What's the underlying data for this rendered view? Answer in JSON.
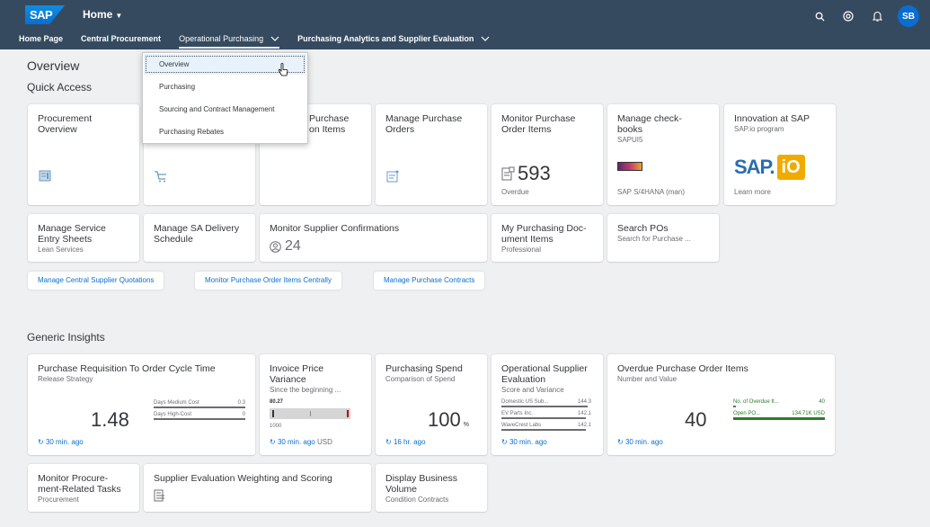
{
  "shell": {
    "logo": "SAP",
    "title": "Home",
    "avatar": "SB",
    "nav": [
      "Home Page",
      "Central Procurement",
      "Operational Purchasing",
      "Purchasing Analytics and Supplier Evaluation"
    ]
  },
  "menu": {
    "items": [
      "Overview",
      "Purchasing",
      "Sourcing and Contract Management",
      "Purchasing Rebates"
    ]
  },
  "page": {
    "title": "Overview",
    "quick_access": "Quick Access",
    "generic_insights": "Generic Insights"
  },
  "quick": {
    "t1": {
      "title": "Procurement Overview"
    },
    "t3": {
      "title_a": "Purchase",
      "title_b": "on Items"
    },
    "t4": {
      "title": "Manage Purchase Orders"
    },
    "t5": {
      "title": "Monitor Purchase Order Items",
      "kpi": "593",
      "foot": "Overdue"
    },
    "t6": {
      "title": "Manage check-books",
      "sub": "SAPUI5",
      "foot": "SAP S/4HANA (man)"
    },
    "t7": {
      "title": "Innovation at SAP",
      "sub": "SAP.io program",
      "logo": "SAP.",
      "logo2": "iO",
      "foot": "Learn more"
    },
    "r2a": {
      "title": "Manage Service Entry Sheets",
      "sub": "Lean Services"
    },
    "r2b": {
      "title": "Manage SA Delivery Schedule"
    },
    "r2c": {
      "title": "Monitor Supplier Confirmations",
      "kpi": "24"
    },
    "r2d": {
      "title": "My Purchasing Doc-ument Items",
      "sub": "Professional"
    },
    "r2e": {
      "title": "Search POs",
      "sub": "Search for Purchase ..."
    }
  },
  "links": [
    "Manage Central Supplier Quotations",
    "Monitor Purchase Order Items Centrally",
    "Manage Purchase Contracts"
  ],
  "insights": {
    "g1": {
      "title": "Purchase Requisition To Order Cycle Time",
      "sub": "Release Strategy",
      "kpi": "1.48",
      "foot": "30 min. ago",
      "rows": [
        {
          "label": "Days Medium Cost",
          "value": "0.3"
        },
        {
          "label": "Days High-Cost",
          "value": "0"
        }
      ]
    },
    "g2": {
      "title": "Invoice Price Variance",
      "sub": "Since the beginning ...",
      "top": "80.27",
      "bottom": "1000",
      "foot": "30 min. ago",
      "unit": "USD"
    },
    "g3": {
      "title": "Purchasing Spend",
      "sub": "Comparison of Spend",
      "kpi": "100",
      "unit": "%",
      "foot": "16 hr. ago"
    },
    "g4": {
      "title": "Operational Supplier Evaluation",
      "sub": "Score and Variance",
      "foot": "30 min. ago",
      "rows": [
        {
          "label": "Domestic US Sub...",
          "value": "144.3"
        },
        {
          "label": "EV Parts Inc.",
          "value": "142.1"
        },
        {
          "label": "WaveCrest Labs",
          "value": "142.1"
        }
      ]
    },
    "g5": {
      "title": "Overdue Purchase Order Items",
      "sub": "Number and Value",
      "kpi": "40",
      "foot": "30 min. ago",
      "rows": [
        {
          "label": "No. of Overdue It...",
          "value": "40"
        },
        {
          "label": "Open PO...",
          "value": "134.71K USD"
        }
      ]
    },
    "h1": {
      "title": "Monitor Procure-ment-Related Tasks",
      "sub": "Procurement"
    },
    "h2": {
      "title": "Supplier Evaluation Weighting and Scoring"
    },
    "h3": {
      "title": "Display Business Volume",
      "sub": "Condition Contracts"
    }
  },
  "colors": {
    "shell": "#354a5f",
    "accent": "#0a6ed1",
    "positive": "#2b7d2b",
    "neutral": "#6a6d70"
  }
}
